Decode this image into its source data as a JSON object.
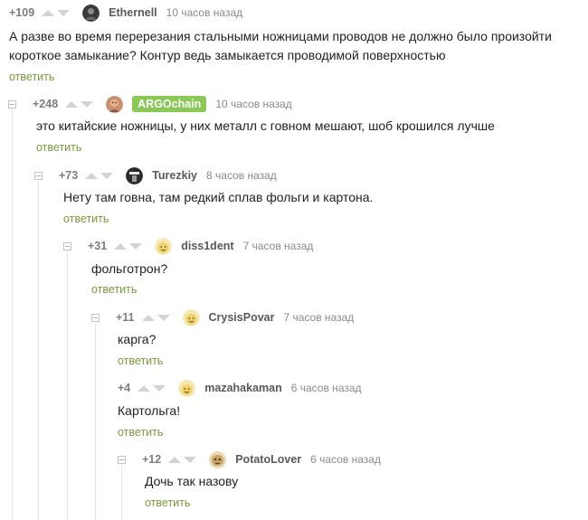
{
  "comments": [
    {
      "rating": "+109",
      "user": "Ethernell",
      "time": "10 часов назад",
      "avatar": "dark-photo",
      "text": "А разве во время перерезания стальными ножницами проводов не должно было произойти короткое замыкание? Контур ведь замыкается проводимой поверхностью",
      "reply": "ответить"
    },
    {
      "rating": "+248",
      "user": "ARGOchain",
      "time": "10 часов назад",
      "avatar": "face-photo",
      "text": "это китайские ножницы, у них металл с говном мешают, шоб крошился лучше",
      "reply": "ответить"
    },
    {
      "rating": "+73",
      "user": "Turezkiy",
      "time": "8 часов назад",
      "avatar": "dark-figure",
      "text": "Нету там говна, там редкий сплав фольги и картона.",
      "reply": "ответить"
    },
    {
      "rating": "+31",
      "user": "diss1dent",
      "time": "7 часов назад",
      "avatar": "yellow-face",
      "text": "фольготрон?",
      "reply": "ответить"
    },
    {
      "rating": "+11",
      "user": "CrysisPovar",
      "time": "7 часов назад",
      "avatar": "yellow-face",
      "text": "карга?",
      "reply": "ответить"
    },
    {
      "rating": "+4",
      "user": "mazahakaman",
      "time": "6 часов назад",
      "avatar": "yellow-face",
      "text": "Картольга!",
      "reply": "ответить"
    },
    {
      "rating": "+12",
      "user": "PotatoLover",
      "time": "6 часов назад",
      "avatar": "potato-face",
      "text": "Дочь так назову",
      "reply": "ответить"
    }
  ],
  "colors": {
    "reply_link": "#7a9a3e",
    "badge": "#8ac858",
    "vote_arrow": "#d3d3d3"
  }
}
